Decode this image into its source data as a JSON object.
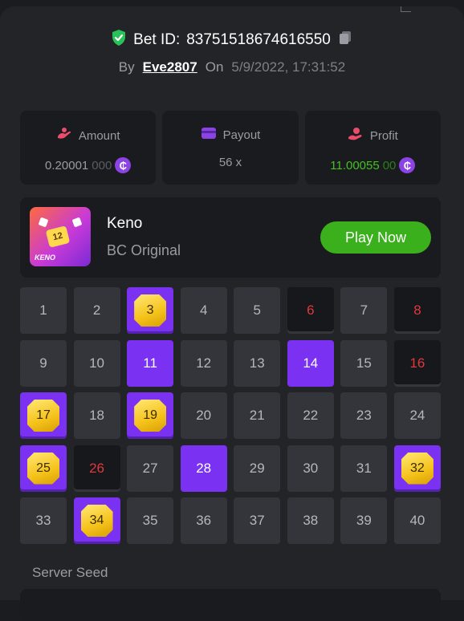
{
  "header": {
    "bet_label": "Bet ID:",
    "bet_id": "83751518674616550",
    "by_label": "By",
    "user": "Eve2807",
    "on_label": "On",
    "datetime": "5/9/2022, 17:31:52"
  },
  "stats": {
    "amount": {
      "label": "Amount",
      "value_main": "0.20001",
      "value_dim": "000"
    },
    "payout": {
      "label": "Payout",
      "value": "56 x"
    },
    "profit": {
      "label": "Profit",
      "value_main": "11.00055",
      "value_dim": "00"
    }
  },
  "game": {
    "thumb_number": "12",
    "thumb_text": "KENO",
    "name": "Keno",
    "provider": "BC Original",
    "play_label": "Play Now"
  },
  "grid": [
    {
      "n": "1",
      "state": "normal"
    },
    {
      "n": "2",
      "state": "normal"
    },
    {
      "n": "3",
      "state": "hit"
    },
    {
      "n": "4",
      "state": "normal"
    },
    {
      "n": "5",
      "state": "normal"
    },
    {
      "n": "6",
      "state": "miss"
    },
    {
      "n": "7",
      "state": "normal"
    },
    {
      "n": "8",
      "state": "miss"
    },
    {
      "n": "9",
      "state": "normal"
    },
    {
      "n": "10",
      "state": "normal"
    },
    {
      "n": "11",
      "state": "selected"
    },
    {
      "n": "12",
      "state": "normal"
    },
    {
      "n": "13",
      "state": "normal"
    },
    {
      "n": "14",
      "state": "selected"
    },
    {
      "n": "15",
      "state": "normal"
    },
    {
      "n": "16",
      "state": "miss"
    },
    {
      "n": "17",
      "state": "hit"
    },
    {
      "n": "18",
      "state": "normal"
    },
    {
      "n": "19",
      "state": "hit"
    },
    {
      "n": "20",
      "state": "normal"
    },
    {
      "n": "21",
      "state": "normal"
    },
    {
      "n": "22",
      "state": "normal"
    },
    {
      "n": "23",
      "state": "normal"
    },
    {
      "n": "24",
      "state": "normal"
    },
    {
      "n": "25",
      "state": "hit"
    },
    {
      "n": "26",
      "state": "miss"
    },
    {
      "n": "27",
      "state": "normal"
    },
    {
      "n": "28",
      "state": "selected"
    },
    {
      "n": "29",
      "state": "normal"
    },
    {
      "n": "30",
      "state": "normal"
    },
    {
      "n": "31",
      "state": "normal"
    },
    {
      "n": "32",
      "state": "hit"
    },
    {
      "n": "33",
      "state": "normal"
    },
    {
      "n": "34",
      "state": "hit"
    },
    {
      "n": "35",
      "state": "normal"
    },
    {
      "n": "36",
      "state": "normal"
    },
    {
      "n": "37",
      "state": "normal"
    },
    {
      "n": "38",
      "state": "normal"
    },
    {
      "n": "39",
      "state": "normal"
    },
    {
      "n": "40",
      "state": "normal"
    }
  ],
  "seed": {
    "label": "Server Seed"
  },
  "colors": {
    "accent": "#7a31f2",
    "green": "#3ab01c",
    "miss_red": "#e0383d",
    "gem": "#f5c21a"
  }
}
